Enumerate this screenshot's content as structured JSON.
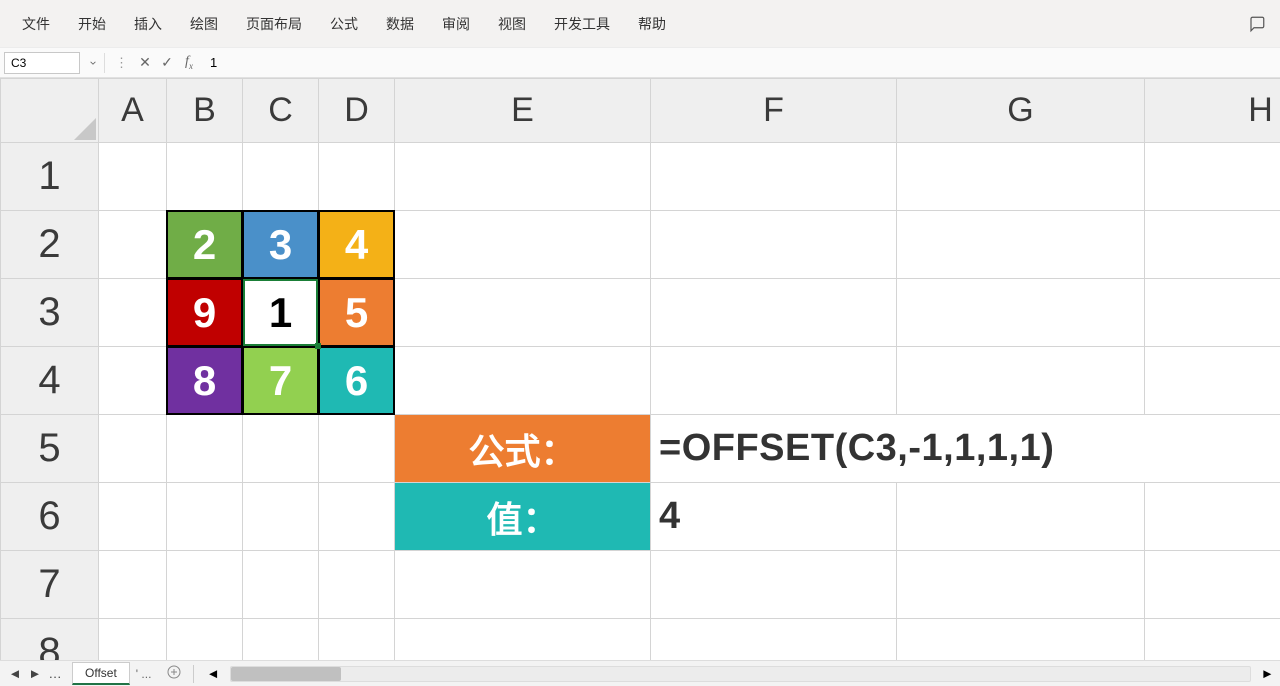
{
  "menu": {
    "items": [
      "文件",
      "开始",
      "插入",
      "绘图",
      "页面布局",
      "公式",
      "数据",
      "审阅",
      "视图",
      "开发工具",
      "帮助"
    ]
  },
  "formula_bar": {
    "name_box": "C3",
    "value": "1"
  },
  "columns": [
    "A",
    "B",
    "C",
    "D",
    "E",
    "F",
    "G",
    "H"
  ],
  "rows": [
    "1",
    "2",
    "3",
    "4",
    "5",
    "6",
    "7",
    "8"
  ],
  "selection": {
    "col": "C",
    "row": "3",
    "cell": "C3"
  },
  "cells": {
    "B2": {
      "v": "2",
      "bg": "c-green"
    },
    "C2": {
      "v": "3",
      "bg": "c-blue"
    },
    "D2": {
      "v": "4",
      "bg": "c-yellow"
    },
    "B3": {
      "v": "9",
      "bg": "c-red"
    },
    "C3": {
      "v": "1",
      "bg": "c-white",
      "txt": "txt-black"
    },
    "D3": {
      "v": "5",
      "bg": "c-orange"
    },
    "B4": {
      "v": "8",
      "bg": "c-purple"
    },
    "C4": {
      "v": "7",
      "bg": "c-lgreen"
    },
    "D4": {
      "v": "6",
      "bg": "c-teal"
    },
    "E5": {
      "label": "公式：",
      "lbl": "lbl-orange"
    },
    "E6": {
      "label": "值：",
      "lbl": "lbl-teal"
    },
    "F5": {
      "text": "=OFFSET(C3,-1,1,1,1)"
    },
    "F6": {
      "text": "4"
    }
  },
  "sheet_tabs": {
    "active": "Offset",
    "other": "' ..."
  }
}
